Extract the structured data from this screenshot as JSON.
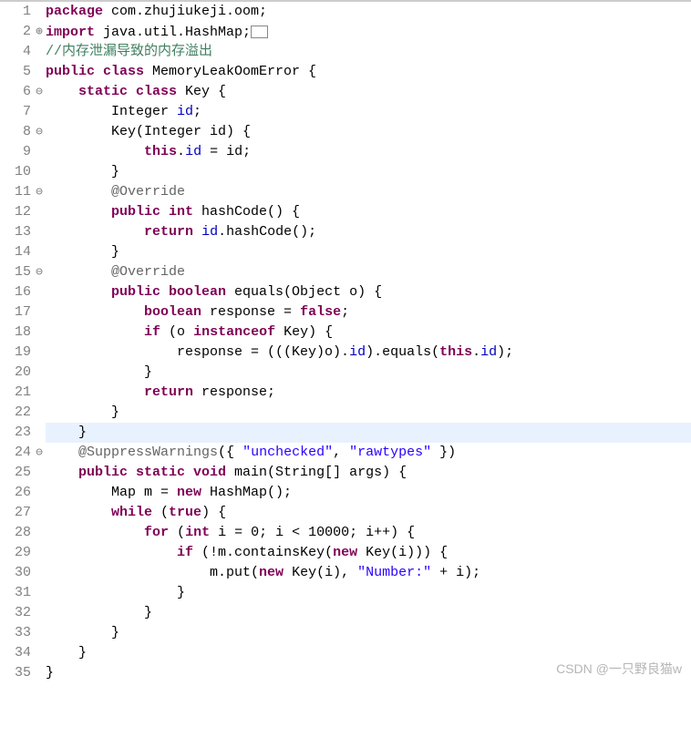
{
  "watermark": "CSDN @一只野良猫w",
  "lines": [
    {
      "num": "1",
      "fold": "",
      "hl": false,
      "segs": [
        [
          "kw",
          "package"
        ],
        [
          "plain",
          " com.zhujiukeji.oom;"
        ]
      ]
    },
    {
      "num": "2",
      "fold": "⊕",
      "hl": false,
      "segs": [
        [
          "kw",
          "import"
        ],
        [
          "plain",
          " java.util.HashMap;"
        ],
        [
          "box",
          "  "
        ]
      ]
    },
    {
      "num": "4",
      "fold": "",
      "hl": false,
      "segs": [
        [
          "cm",
          "//内存泄漏导致的内存溢出"
        ]
      ]
    },
    {
      "num": "5",
      "fold": "",
      "hl": false,
      "segs": [
        [
          "kw",
          "public class"
        ],
        [
          "plain",
          " MemoryLeakOomError {"
        ]
      ]
    },
    {
      "num": "6",
      "fold": "⊖",
      "hl": false,
      "segs": [
        [
          "plain",
          "    "
        ],
        [
          "kw",
          "static class"
        ],
        [
          "plain",
          " Key {"
        ]
      ]
    },
    {
      "num": "7",
      "fold": "",
      "hl": false,
      "segs": [
        [
          "plain",
          "        Integer "
        ],
        [
          "id",
          "id"
        ],
        [
          "plain",
          ";"
        ]
      ]
    },
    {
      "num": "8",
      "fold": "⊖",
      "hl": false,
      "segs": [
        [
          "plain",
          "        Key(Integer id) {"
        ]
      ]
    },
    {
      "num": "9",
      "fold": "",
      "hl": false,
      "segs": [
        [
          "plain",
          "            "
        ],
        [
          "kw",
          "this"
        ],
        [
          "plain",
          "."
        ],
        [
          "id",
          "id"
        ],
        [
          "plain",
          " = id;"
        ]
      ]
    },
    {
      "num": "10",
      "fold": "",
      "hl": false,
      "segs": [
        [
          "plain",
          "        }"
        ]
      ]
    },
    {
      "num": "11",
      "fold": "⊖",
      "hl": false,
      "segs": [
        [
          "plain",
          "        "
        ],
        [
          "ann",
          "@Override"
        ]
      ]
    },
    {
      "num": "12",
      "fold": "",
      "hl": false,
      "segs": [
        [
          "plain",
          "        "
        ],
        [
          "kw",
          "public int"
        ],
        [
          "plain",
          " hashCode() {"
        ]
      ]
    },
    {
      "num": "13",
      "fold": "",
      "hl": false,
      "segs": [
        [
          "plain",
          "            "
        ],
        [
          "kw",
          "return"
        ],
        [
          "plain",
          " "
        ],
        [
          "id",
          "id"
        ],
        [
          "plain",
          ".hashCode();"
        ]
      ]
    },
    {
      "num": "14",
      "fold": "",
      "hl": false,
      "segs": [
        [
          "plain",
          "        }"
        ]
      ]
    },
    {
      "num": "15",
      "fold": "⊖",
      "hl": false,
      "segs": [
        [
          "plain",
          "        "
        ],
        [
          "ann",
          "@Override"
        ]
      ]
    },
    {
      "num": "16",
      "fold": "",
      "hl": false,
      "segs": [
        [
          "plain",
          "        "
        ],
        [
          "kw",
          "public boolean"
        ],
        [
          "plain",
          " equals(Object o) {"
        ]
      ]
    },
    {
      "num": "17",
      "fold": "",
      "hl": false,
      "segs": [
        [
          "plain",
          "            "
        ],
        [
          "kw",
          "boolean"
        ],
        [
          "plain",
          " response = "
        ],
        [
          "kw",
          "false"
        ],
        [
          "plain",
          ";"
        ]
      ]
    },
    {
      "num": "18",
      "fold": "",
      "hl": false,
      "segs": [
        [
          "plain",
          "            "
        ],
        [
          "kw",
          "if"
        ],
        [
          "plain",
          " (o "
        ],
        [
          "kw",
          "instanceof"
        ],
        [
          "plain",
          " Key) {"
        ]
      ]
    },
    {
      "num": "19",
      "fold": "",
      "hl": false,
      "segs": [
        [
          "plain",
          "                response = (((Key)o)."
        ],
        [
          "id",
          "id"
        ],
        [
          "plain",
          ").equals("
        ],
        [
          "kw",
          "this"
        ],
        [
          "plain",
          "."
        ],
        [
          "id",
          "id"
        ],
        [
          "plain",
          ");"
        ]
      ]
    },
    {
      "num": "20",
      "fold": "",
      "hl": false,
      "segs": [
        [
          "plain",
          "            }"
        ]
      ]
    },
    {
      "num": "21",
      "fold": "",
      "hl": false,
      "segs": [
        [
          "plain",
          "            "
        ],
        [
          "kw",
          "return"
        ],
        [
          "plain",
          " response;"
        ]
      ]
    },
    {
      "num": "22",
      "fold": "",
      "hl": false,
      "segs": [
        [
          "plain",
          "        }"
        ]
      ]
    },
    {
      "num": "23",
      "fold": "",
      "hl": true,
      "segs": [
        [
          "plain",
          "    }"
        ]
      ]
    },
    {
      "num": "24",
      "fold": "⊖",
      "hl": false,
      "segs": [
        [
          "plain",
          "    "
        ],
        [
          "ann",
          "@SuppressWarnings"
        ],
        [
          "plain",
          "({ "
        ],
        [
          "str",
          "\"unchecked\""
        ],
        [
          "plain",
          ", "
        ],
        [
          "str",
          "\"rawtypes\""
        ],
        [
          "plain",
          " })"
        ]
      ]
    },
    {
      "num": "25",
      "fold": "",
      "hl": false,
      "segs": [
        [
          "plain",
          "    "
        ],
        [
          "kw",
          "public static void"
        ],
        [
          "plain",
          " main(String[] args) {"
        ]
      ]
    },
    {
      "num": "26",
      "fold": "",
      "hl": false,
      "segs": [
        [
          "plain",
          "        Map m = "
        ],
        [
          "kw",
          "new"
        ],
        [
          "plain",
          " HashMap();"
        ]
      ]
    },
    {
      "num": "27",
      "fold": "",
      "hl": false,
      "segs": [
        [
          "plain",
          "        "
        ],
        [
          "kw",
          "while"
        ],
        [
          "plain",
          " ("
        ],
        [
          "kw",
          "true"
        ],
        [
          "plain",
          ") {"
        ]
      ]
    },
    {
      "num": "28",
      "fold": "",
      "hl": false,
      "segs": [
        [
          "plain",
          "            "
        ],
        [
          "kw",
          "for"
        ],
        [
          "plain",
          " ("
        ],
        [
          "kw",
          "int"
        ],
        [
          "plain",
          " i = 0; i < 10000; i++) {"
        ]
      ]
    },
    {
      "num": "29",
      "fold": "",
      "hl": false,
      "segs": [
        [
          "plain",
          "                "
        ],
        [
          "kw",
          "if"
        ],
        [
          "plain",
          " (!m.containsKey("
        ],
        [
          "kw",
          "new"
        ],
        [
          "plain",
          " Key(i))) {"
        ]
      ]
    },
    {
      "num": "30",
      "fold": "",
      "hl": false,
      "segs": [
        [
          "plain",
          "                    m.put("
        ],
        [
          "kw",
          "new"
        ],
        [
          "plain",
          " Key(i), "
        ],
        [
          "str",
          "\"Number:\""
        ],
        [
          "plain",
          " + i);"
        ]
      ]
    },
    {
      "num": "31",
      "fold": "",
      "hl": false,
      "segs": [
        [
          "plain",
          "                }"
        ]
      ]
    },
    {
      "num": "32",
      "fold": "",
      "hl": false,
      "segs": [
        [
          "plain",
          "            }"
        ]
      ]
    },
    {
      "num": "33",
      "fold": "",
      "hl": false,
      "segs": [
        [
          "plain",
          "        }"
        ]
      ]
    },
    {
      "num": "34",
      "fold": "",
      "hl": false,
      "segs": [
        [
          "plain",
          "    }"
        ]
      ]
    },
    {
      "num": "35",
      "fold": "",
      "hl": false,
      "segs": [
        [
          "plain",
          "}"
        ]
      ]
    }
  ]
}
